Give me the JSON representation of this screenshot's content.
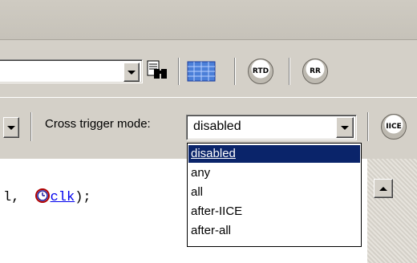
{
  "toolbar1": {
    "search_value": "",
    "icons": [
      "binoculars-icon",
      "grid-view-icon",
      "rtd-icon",
      "rr-icon"
    ],
    "rtd_label": "RTD",
    "rr_label": "RR"
  },
  "toolbar2": {
    "cross_trigger_label": "Cross trigger mode:",
    "cross_trigger_value": "disabled",
    "iice_label": "IICE"
  },
  "dropdown": {
    "options": [
      "disabled",
      "any",
      "all",
      "after-IICE",
      "after-all"
    ],
    "selected": "disabled"
  },
  "editor": {
    "code_prefix": "l,",
    "code_link": "clk",
    "code_suffix": ");"
  }
}
